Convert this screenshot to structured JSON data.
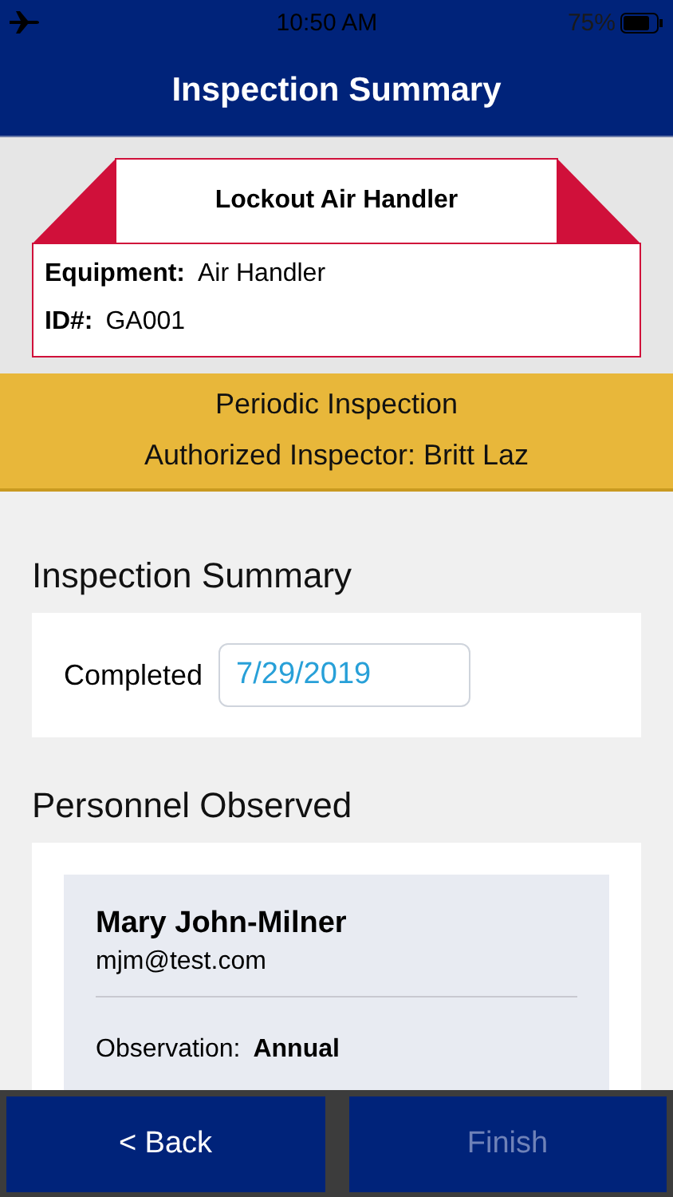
{
  "status_bar": {
    "time": "10:50 AM",
    "battery": "75%"
  },
  "header": {
    "title": "Inspection Summary"
  },
  "tag": {
    "title": "Lockout Air Handler",
    "fields": [
      {
        "label": "Equipment:",
        "value": "Air Handler"
      },
      {
        "label": "ID#:",
        "value": "GA001"
      }
    ]
  },
  "banner": {
    "type": "Periodic Inspection",
    "inspector": "Authorized Inspector: Britt Laz"
  },
  "summary": {
    "heading": "Inspection Summary",
    "label": "Completed",
    "value": "7/29/2019"
  },
  "personnel": {
    "heading": "Personnel Observed",
    "people": [
      {
        "name": "Mary John-Milner",
        "email": "mjm@test.com",
        "fields": [
          {
            "label": "Observation:",
            "value": "Annual"
          }
        ]
      }
    ]
  },
  "buttons": [
    {
      "label": "< Back",
      "disabled": false
    },
    {
      "label": "Finish",
      "disabled": true
    }
  ]
}
